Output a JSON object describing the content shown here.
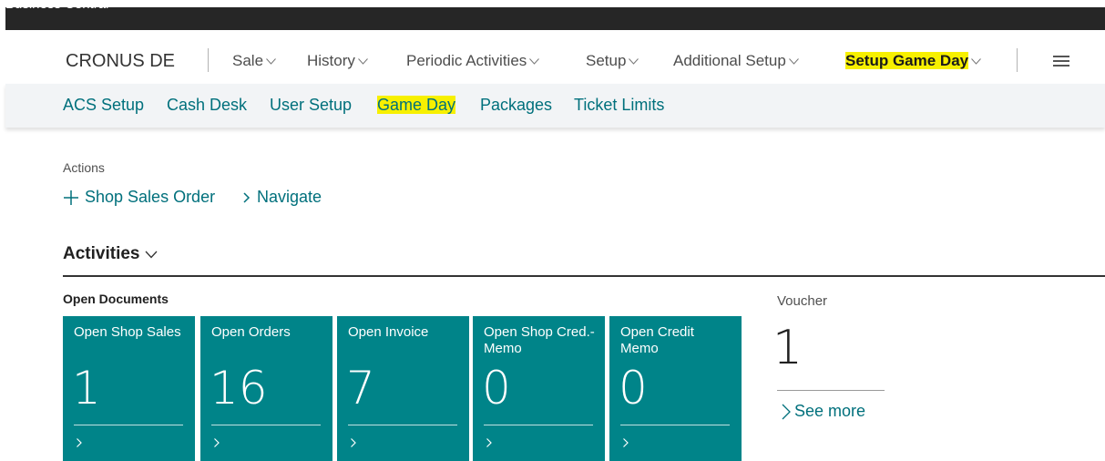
{
  "app": {
    "title": "Business Central"
  },
  "header": {
    "company": "CRONUS DE",
    "nav": [
      {
        "label": "Sale"
      },
      {
        "label": "History"
      },
      {
        "label": "Periodic Activities"
      },
      {
        "label": "Setup"
      },
      {
        "label": "Additional Setup"
      },
      {
        "label": "Setup Game Day",
        "highlighted": true
      }
    ],
    "menu_icon": "hamburger-icon"
  },
  "subnav": [
    {
      "label": "ACS Setup"
    },
    {
      "label": "Cash Desk"
    },
    {
      "label": "User Setup"
    },
    {
      "label": "Game Day",
      "highlighted": true
    },
    {
      "label": "Packages"
    },
    {
      "label": "Ticket Limits"
    }
  ],
  "actions": {
    "heading": "Actions",
    "items": [
      {
        "label": "Shop Sales Order",
        "icon": "plus-icon"
      },
      {
        "label": "Navigate",
        "icon": "chevron-right-icon"
      }
    ]
  },
  "activities": {
    "heading": "Activities",
    "group_heading": "Open Documents",
    "tiles": [
      {
        "title": "Open Shop Sales",
        "value": "1"
      },
      {
        "title": "Open Orders",
        "value": "16"
      },
      {
        "title": "Open Invoice",
        "value": "7"
      },
      {
        "title": "Open Shop Cred.-Memo",
        "value": "0"
      },
      {
        "title": "Open Credit Memo",
        "value": "0"
      }
    ],
    "voucher": {
      "label": "Voucher",
      "value": "1",
      "see_more": "See more"
    }
  },
  "colors": {
    "accent": "#00707c",
    "tile_bg": "#008489",
    "highlight": "#f7f000",
    "top_bar": "#262626",
    "subnav_bg": "#f2f4f6"
  }
}
